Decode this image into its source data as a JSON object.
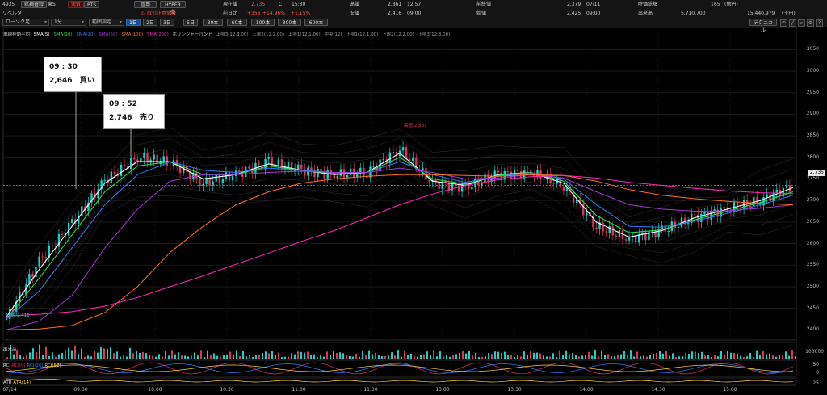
{
  "toolbar": {
    "code": "4935",
    "name_button": "銘柄登録",
    "exchange": "東S",
    "buttons": {
      "jitsu": "実質",
      "pts": "PTS",
      "shinyo": "信用",
      "hyper": "HYPER売",
      "warning": "取引注意情報"
    },
    "company": "リベルタ",
    "chart_type": "ローソク足",
    "interval": "1分",
    "zoom": "範囲指定",
    "periods": [
      "1日",
      "2日",
      "3日",
      "5日",
      "30本",
      "60本",
      "100本",
      "300本",
      "600本"
    ],
    "technical": "テクニカル"
  },
  "quote": {
    "current_label": "現在値",
    "current_value": "2,735",
    "current_mark": "C",
    "current_time": "15:30",
    "change_label": "前日比",
    "change_value": "+356",
    "change_pct": "+14.96%",
    "change_pct2": "+1.15%",
    "high_label": "高値",
    "high_value": "2,861",
    "high_time": "12:57",
    "low_label": "安値",
    "low_value": "2,416",
    "low_time": "09:00",
    "prev_label": "前終値",
    "prev_value": "2,379",
    "prev_date": "07/11",
    "open_label": "始値",
    "open_value": "2,425",
    "open_time": "09:00",
    "mcap_label": "時価総額",
    "mcap_value": "165",
    "mcap_unit": "(億円)",
    "volume_label": "出来高",
    "volume_value": "5,710,700",
    "turnover_value": "15,440,979",
    "turnover_unit": "(千円)"
  },
  "legend": {
    "prefix": "単純移動平均",
    "sma5": "SMA(5)",
    "sma10": "SMA(10)",
    "sma20": "SMA(20)",
    "sma50": "SMA(50)",
    "sma100": "SMA(100)",
    "sma200": "SMA(200)",
    "bb": "ボリンジャーバンド",
    "bb_items": [
      "上限3(12,3.00)",
      "上限2(12,2.00)",
      "上限1(12,1.00)",
      "中央(12)",
      "下限1(12,1.00)",
      "下限2(12,2.00)",
      "下限3(12,3.00)"
    ]
  },
  "annotations": {
    "high_marker": "高値:2,861",
    "low_marker": "安値:2,416",
    "callout1": {
      "time": "09 : 30",
      "price": "2,646",
      "action": "買い"
    },
    "callout2": {
      "time": "09 : 52",
      "price": "2,746",
      "action": "売り"
    }
  },
  "price_axis": [
    "3050",
    "3000",
    "2950",
    "2900",
    "2850",
    "2800",
    "2750",
    "2700",
    "2650",
    "2600",
    "2550",
    "2500",
    "2450",
    "2400"
  ],
  "current_price_tag": "2,735",
  "volume_panel": {
    "label": "出来高",
    "axis_max": "100000"
  },
  "rci_panel": {
    "label": "RCI",
    "items": [
      "RCI(9)",
      "RCI(26)",
      "RCI(52)"
    ],
    "axis": [
      "50",
      "0"
    ]
  },
  "atr_panel": {
    "label": "ATR",
    "item": "ATR(14)",
    "axis": "25"
  },
  "time_axis": [
    "07/14",
    "09:30",
    "10:00",
    "10:30",
    "11:00",
    "11:30",
    "13:00",
    "13:30",
    "14:00",
    "14:30",
    "15:00"
  ],
  "colors": {
    "sma5": "#ffffff",
    "sma10": "#21e05a",
    "sma20": "#2f7cf4",
    "sma50": "#a03bd6",
    "sma100": "#ff6f1a",
    "sma200": "#ff2bb7",
    "up": "#17d3c5",
    "down": "#e0345a"
  },
  "chart_data": {
    "type": "candlestick",
    "x": [
      "09:00",
      "09:15",
      "09:30",
      "09:45",
      "10:00",
      "10:15",
      "10:30",
      "10:45",
      "11:00",
      "11:15",
      "11:30",
      "12:30",
      "12:45",
      "13:00",
      "13:15",
      "13:30",
      "13:45",
      "14:00",
      "14:10",
      "14:20",
      "14:30",
      "14:45",
      "15:00",
      "15:15",
      "15:25"
    ],
    "close": [
      2425,
      2560,
      2646,
      2746,
      2800,
      2790,
      2740,
      2760,
      2790,
      2770,
      2760,
      2765,
      2820,
      2740,
      2730,
      2760,
      2765,
      2735,
      2640,
      2610,
      2630,
      2660,
      2680,
      2700,
      2735
    ],
    "ylim": [
      2380,
      3075
    ],
    "series": [
      {
        "name": "SMA(5)",
        "values": [
          2430,
          2540,
          2640,
          2740,
          2790,
          2790,
          2750,
          2760,
          2785,
          2770,
          2760,
          2765,
          2810,
          2745,
          2735,
          2760,
          2765,
          2740,
          2650,
          2615,
          2630,
          2660,
          2680,
          2700,
          2730
        ]
      },
      {
        "name": "SMA(10)",
        "values": [
          2425,
          2520,
          2620,
          2720,
          2780,
          2790,
          2760,
          2760,
          2780,
          2770,
          2762,
          2765,
          2800,
          2750,
          2738,
          2758,
          2765,
          2745,
          2665,
          2625,
          2632,
          2655,
          2675,
          2695,
          2720
        ]
      },
      {
        "name": "SMA(20)",
        "values": [
          2425,
          2490,
          2590,
          2690,
          2760,
          2790,
          2770,
          2765,
          2775,
          2770,
          2765,
          2765,
          2790,
          2760,
          2742,
          2756,
          2764,
          2750,
          2690,
          2640,
          2638,
          2652,
          2670,
          2690,
          2712
        ]
      },
      {
        "name": "SMA(50)",
        "values": [
          2400,
          2420,
          2480,
          2590,
          2680,
          2745,
          2760,
          2760,
          2765,
          2768,
          2765,
          2765,
          2775,
          2765,
          2750,
          2752,
          2760,
          2752,
          2720,
          2690,
          2680,
          2675,
          2676,
          2682,
          2690
        ]
      },
      {
        "name": "SMA(100)",
        "values": [
          2400,
          2402,
          2410,
          2440,
          2500,
          2580,
          2640,
          2690,
          2720,
          2740,
          2750,
          2756,
          2760,
          2760,
          2758,
          2756,
          2760,
          2758,
          2745,
          2725,
          2712,
          2704,
          2698,
          2693,
          2690
        ]
      },
      {
        "name": "SMA(200)",
        "values": [
          2432,
          2436,
          2442,
          2455,
          2475,
          2500,
          2525,
          2552,
          2578,
          2605,
          2630,
          2660,
          2690,
          2715,
          2735,
          2748,
          2755,
          2758,
          2752,
          2742,
          2735,
          2728,
          2722,
          2718,
          2716
        ]
      }
    ]
  }
}
